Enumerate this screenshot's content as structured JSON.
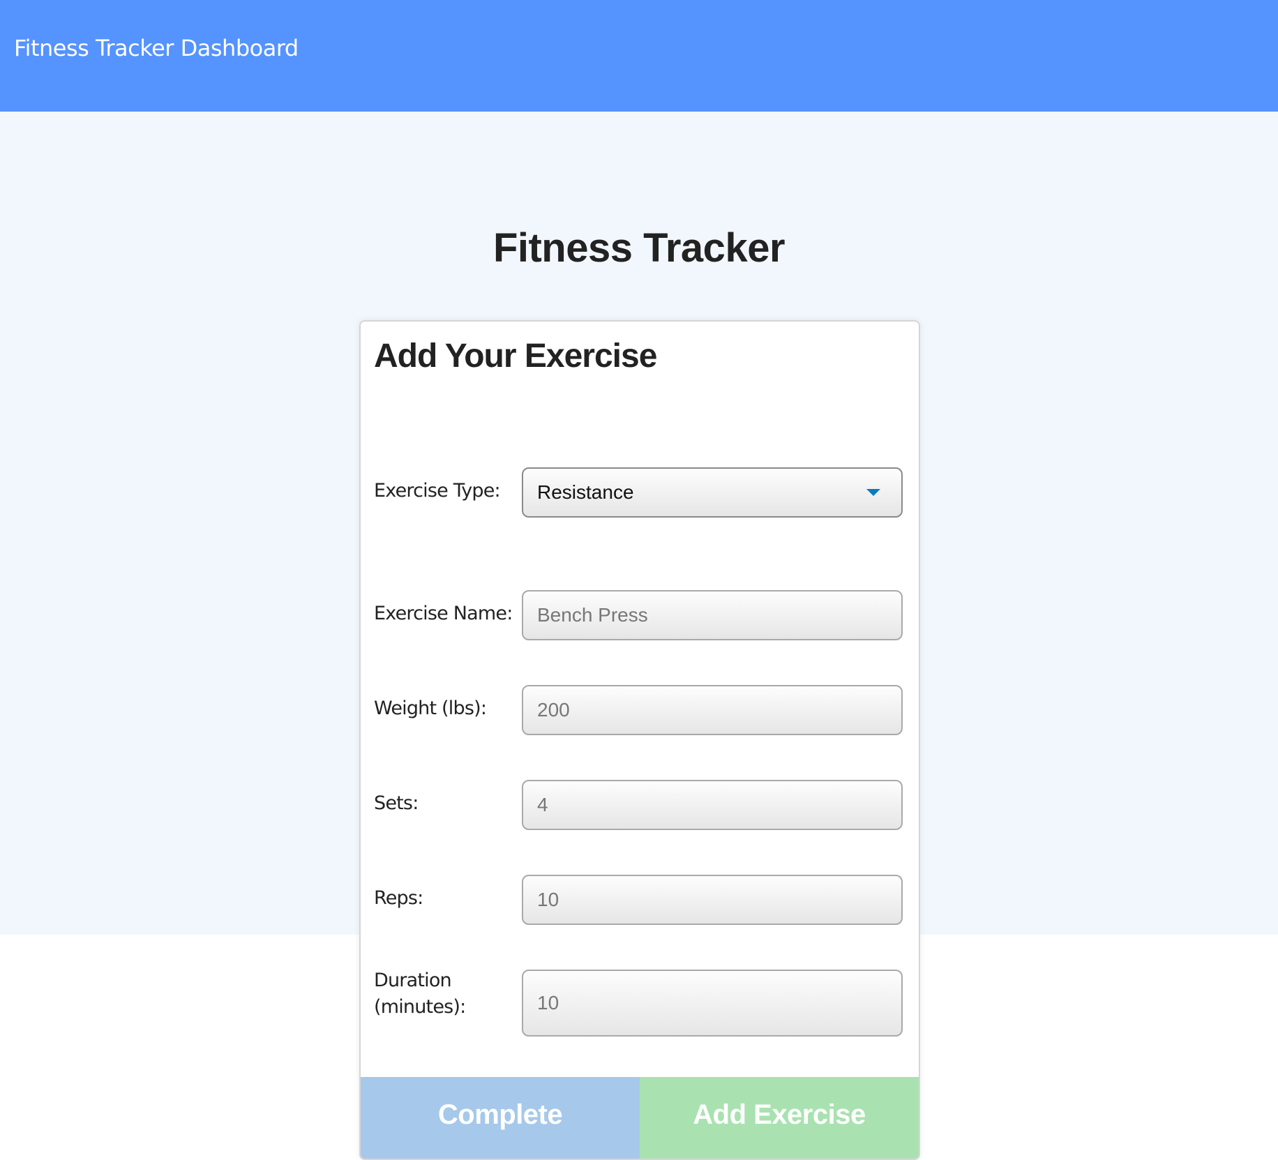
{
  "header": {
    "title": "Fitness Tracker Dashboard",
    "bg_color": "#5593FE"
  },
  "page": {
    "title": "Fitness Tracker",
    "bg_color": "#F2F7FE"
  },
  "form": {
    "title": "Add Your Exercise",
    "fields": {
      "exercise_type": {
        "label": "Exercise Type:",
        "value": "Resistance",
        "icon": "caret-down-icon"
      },
      "exercise_name": {
        "label": "Exercise Name:",
        "placeholder": "Bench Press"
      },
      "weight": {
        "label": "Weight (lbs):",
        "placeholder": "200"
      },
      "sets": {
        "label": "Sets:",
        "placeholder": "4"
      },
      "reps": {
        "label": "Reps:",
        "placeholder": "10"
      },
      "duration": {
        "label_line1": "Duration",
        "label_line2": "(minutes):",
        "placeholder": "10"
      }
    },
    "buttons": {
      "complete": {
        "label": "Complete",
        "color": "#A6C8EA"
      },
      "add_exercise": {
        "label": "Add Exercise",
        "color": "#A9E2B0"
      }
    }
  }
}
